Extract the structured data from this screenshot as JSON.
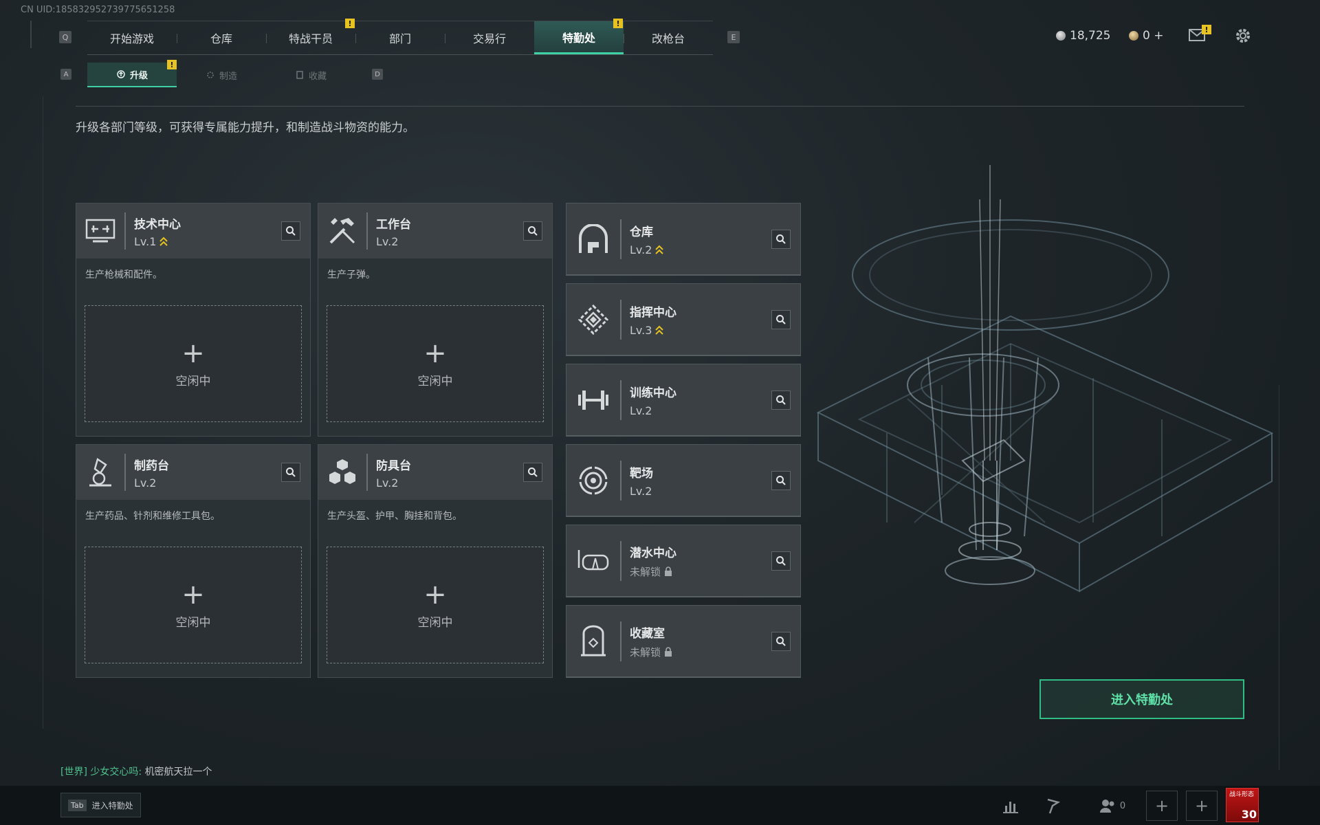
{
  "uid": "CN UID:1858329527397756512​58",
  "keys": {
    "prev_tab": "Q",
    "next_tab": "E",
    "prev_sub": "A",
    "next_sub": "D",
    "tab": "Tab"
  },
  "nav": {
    "tabs": [
      "开始游戏",
      "仓库",
      "特战干员",
      "部门",
      "交易行",
      "特勤处",
      "改枪台"
    ],
    "active": "特勤处",
    "warn_mark": "!"
  },
  "currencies": {
    "primary": "18,725",
    "secondary": "0 +"
  },
  "subnav": {
    "upgrade": "升级",
    "craft": "制造",
    "collect": "收藏"
  },
  "description": "升级各部门等级，可获得专属能力提升，和制造战斗物资的能力。",
  "benches": [
    {
      "name": "技术中心",
      "level": "Lv.1",
      "desc": "生产枪械和配件。",
      "slot_plus": "+",
      "slot_status": "空闲中",
      "icon": "tech-center-icon"
    },
    {
      "name": "工作台",
      "level": "Lv.2",
      "desc": "生产子弹。",
      "slot_plus": "+",
      "slot_status": "空闲中",
      "icon": "workbench-icon"
    },
    {
      "name": "制药台",
      "level": "Lv.2",
      "desc": "生产药品、针剂和维修工具包。",
      "slot_plus": "+",
      "slot_status": "空闲中",
      "icon": "pharmacy-icon"
    },
    {
      "name": "防具台",
      "level": "Lv.2",
      "desc": "生产头盔、护甲、胸挂和背包。",
      "slot_plus": "+",
      "slot_status": "空闲中",
      "icon": "armor-bench-icon"
    }
  ],
  "departments": [
    {
      "name": "仓库",
      "level": "Lv.2",
      "upgradable": true,
      "icon": "warehouse-icon"
    },
    {
      "name": "指挥中心",
      "level": "Lv.3",
      "upgradable": true,
      "icon": "command-center-icon"
    },
    {
      "name": "训练中心",
      "level": "Lv.2",
      "upgradable": false,
      "icon": "training-center-icon"
    },
    {
      "name": "靶场",
      "level": "Lv.2",
      "upgradable": false,
      "icon": "shooting-range-icon"
    },
    {
      "name": "潜水中心",
      "level": "未解锁",
      "locked": true,
      "icon": "diving-center-icon"
    },
    {
      "name": "收藏室",
      "level": "未解锁",
      "locked": true,
      "icon": "collection-room-icon"
    }
  ],
  "enter_button": "进入特勤处",
  "chat": {
    "channel": "[世界]",
    "user": "少女交心吗:",
    "message": "机密航天拉一个"
  },
  "bottom": {
    "tab_label": "进入特勤处",
    "friends_count": "0",
    "avatar_text": "战斗形态",
    "avatar_number": "30"
  },
  "colors": {
    "accent": "#3fd1a6",
    "warning": "#e6c323",
    "upgrade_chevron": "#e6c323"
  }
}
